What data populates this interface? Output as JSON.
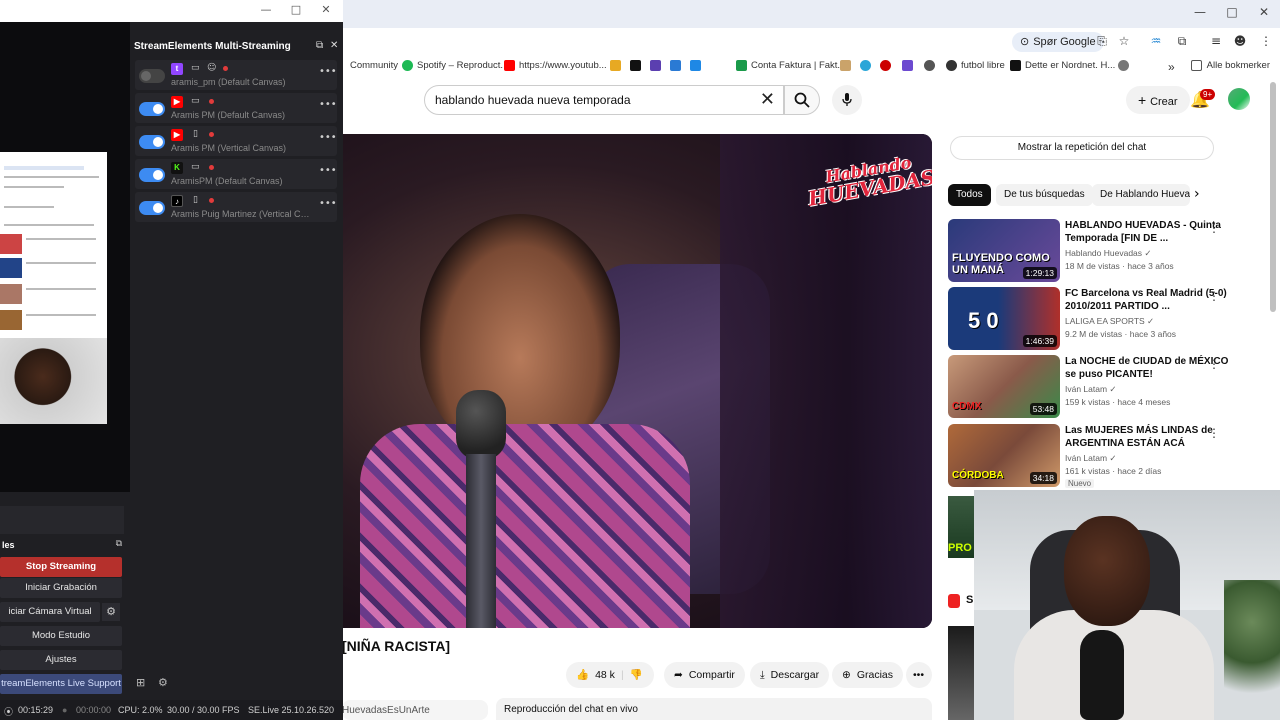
{
  "obs": {
    "titlebar_controls": [
      "—",
      "□",
      "✕"
    ],
    "streamelements_title": "StreamElements Multi-Streaming",
    "destinations": [
      {
        "platform": "twitch",
        "platform_color": "#9146ff",
        "platform_glyph": "t",
        "enabled": false,
        "name": "aramis_pm (Default Canvas)",
        "device_icon": "monitor-icon"
      },
      {
        "platform": "youtube",
        "platform_color": "#ff0000",
        "platform_glyph": "▶",
        "enabled": true,
        "name": "Aramis PM (Default Canvas)",
        "device_icon": "monitor-icon"
      },
      {
        "platform": "youtube",
        "platform_color": "#ff0000",
        "platform_glyph": "▶",
        "enabled": true,
        "name": "Aramis PM (Vertical Canvas)",
        "device_icon": "phone-icon"
      },
      {
        "platform": "kick",
        "platform_color": "#53fc18",
        "platform_glyph": "K",
        "enabled": true,
        "name": "AramisPM (Default Canvas)",
        "device_icon": "monitor-icon"
      },
      {
        "platform": "tiktok",
        "platform_color": "#000000",
        "platform_glyph": "♪",
        "enabled": true,
        "name": "Aramis Puig Martinez (Vertical Ca...",
        "device_icon": "phone-icon"
      }
    ],
    "controls_header": "les",
    "controls": {
      "stop_streaming": "Stop Streaming",
      "start_recording": "Iniciar Grabación",
      "virtual_camera": "iciar Cámara Virtual",
      "studio_mode": "Modo Estudio",
      "settings": "Ajustes",
      "live_support": "treamElements Live Support"
    },
    "status": {
      "live_time": "00:15:29",
      "rec_time": "00:00:00",
      "cpu": "CPU: 2.0%",
      "fps": "30.00 / 30.00 FPS",
      "version": "SE.Live 25.10.26.520"
    }
  },
  "browser": {
    "google_chip": "Spør Google",
    "bookmarks": [
      {
        "label": "Community",
        "color": "#6b6b6b"
      },
      {
        "label": "Spotify – Reproduct...",
        "color": "#1db954"
      },
      {
        "label": "https://www.youtub...",
        "color": "#ff0000"
      },
      {
        "label": "Conta Faktura | Fakt...",
        "color": "#1a9a4a"
      },
      {
        "label": "futbol libre",
        "color": "#333333"
      },
      {
        "label": "Dette er Nordnet. H...",
        "color": "#111111"
      }
    ],
    "all_bookmarks": "Alle bokmerker"
  },
  "youtube": {
    "search_value": "hablando huevada nueva temporada",
    "create_label": "Crear",
    "notif_count": "9+",
    "channel_logo_line1": "Hablando",
    "channel_logo_line2": "HUEVADAS",
    "video_title": "[NIÑA RACISTA]",
    "actions": {
      "likes": "48 k",
      "share": "Compartir",
      "download": "Descargar",
      "thanks": "Gracias"
    },
    "channel_strip": "HuevadasEsUnArte",
    "live_chat_label": "Reproducción del chat en vivo",
    "chat_replay": "Mostrar la repetición del chat",
    "chips": [
      "Todos",
      "De tus búsquedas",
      "De Hablando Hueva"
    ],
    "recommendations": [
      {
        "title": "HABLANDO HUEVADAS - Quinta Temporada [FIN DE ...",
        "channel": "Hablando Huevadas",
        "meta": "18 M de vistas · hace 3 años",
        "duration": "1:29:13",
        "thumb_text": "FLUYENDO COMO UN MANÁ",
        "thumb_color": "#2a3a7a",
        "is_new": false
      },
      {
        "title": "FC Barcelona vs Real Madrid (5-0) 2010/2011 PARTIDO ...",
        "channel": "LALIGA EA SPORTS",
        "meta": "9.2 M de vistas · hace 3 años",
        "duration": "1:46:39",
        "thumb_text": "5 0",
        "thumb_color": "#1b3a7a",
        "is_new": false
      },
      {
        "title": "La NOCHE de CIUDAD de MÉXICO se puso PICANTE!",
        "channel": "Iván Latam",
        "meta": "159 k vistas · hace 4 meses",
        "duration": "53:48",
        "thumb_text": "CDMX",
        "thumb_color": "#8a5a4a",
        "is_new": false
      },
      {
        "title": "Las MUJERES MÁS LINDAS de ARGENTINA ESTÁN ACÁ",
        "channel": "Iván Latam",
        "meta": "161 k vistas · hace 2 días",
        "duration": "34:18",
        "thumb_text": "CÓRDOBA",
        "thumb_color": "#7a4a3a",
        "is_new": true,
        "new_label": "Nuevo"
      }
    ],
    "pro_text": "PRO",
    "shorts_letter": "S"
  }
}
